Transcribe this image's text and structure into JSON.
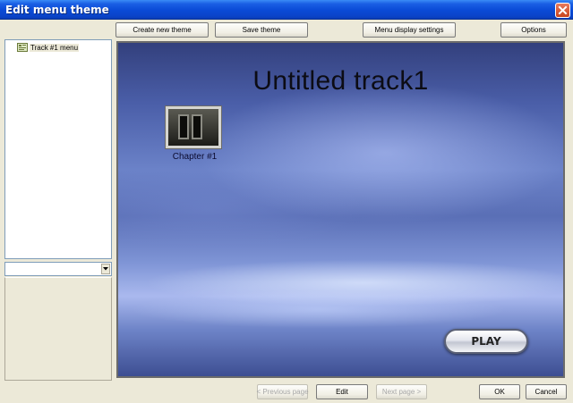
{
  "window": {
    "title": "Edit menu theme"
  },
  "toolbar": {
    "create_new_theme": "Create new theme",
    "save_theme": "Save theme",
    "menu_display_settings": "Menu display settings",
    "options": "Options"
  },
  "tree": {
    "items": [
      {
        "label": "Track #1 menu",
        "icon": "menu-page-icon"
      }
    ]
  },
  "combo": {
    "value": ""
  },
  "preview": {
    "title": "Untitled track1",
    "chapters": [
      {
        "label": "Chapter #1"
      }
    ],
    "play_label": "PLAY"
  },
  "footer": {
    "previous_page": "< Previous page",
    "edit": "Edit",
    "next_page": "Next page >",
    "ok": "OK",
    "cancel": "Cancel"
  },
  "colors": {
    "titlebar": "#0a4ad6",
    "window_bg": "#ece9d8",
    "close_button": "#c9441d"
  }
}
